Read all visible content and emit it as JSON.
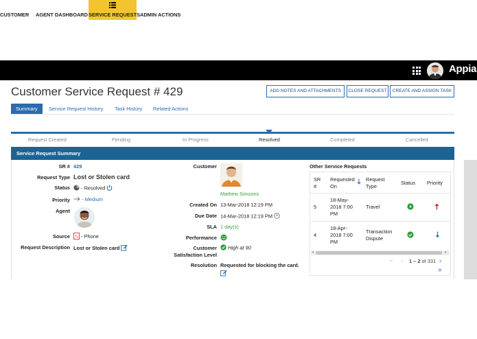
{
  "nav": {
    "items": [
      {
        "label": "CUSTOMER",
        "icon": "users-icon"
      },
      {
        "label": "AGENT DASHBOARD",
        "icon": "user-circle-icon"
      },
      {
        "label": "SERVICE REQUESTS",
        "icon": "list-icon",
        "active": true
      },
      {
        "label": "ADMIN ACTIONS",
        "icon": "move-icon"
      }
    ],
    "brand": "Appian"
  },
  "header": {
    "title": "Customer Service Request # 429",
    "buttons": {
      "add_notes": "ADD NOTES AND ATTACHMENTS",
      "close": "CLOSE REQUEST",
      "create_assign": "CREATE AND ASSIGN TASK"
    }
  },
  "tabs": [
    "Summary",
    "Service Request History",
    "Task History",
    "Related Actions"
  ],
  "stages": [
    "Request Created",
    "Pending",
    "In Progress",
    "Resolved",
    "Completed",
    "Cancelled"
  ],
  "current_stage": "Resolved",
  "panel": {
    "title": "Service Request Summary"
  },
  "summary": {
    "sr_label": "SR #",
    "sr_value": "429",
    "type_label": "Request Type",
    "type_value": "Lost or Stolen card",
    "status_label": "Status",
    "status_value": "- Resolved",
    "priority_label": "Priority",
    "priority_value": "- Medium",
    "agent_label": "Agent",
    "source_label": "Source",
    "source_value": "- Phone",
    "desc_label": "Request Description",
    "desc_value": "Lost or Stolen card"
  },
  "customer": {
    "customer_label": "Customer",
    "customer_name": "Mathew Simsons",
    "created_label": "Created On",
    "created_value": "13-Mar-2018 12:19 PM",
    "due_label": "Due Date",
    "due_value": "14-Mar-2018 12:19 PM",
    "sla_label": "SLA",
    "sla_value": "1 day(s)",
    "perf_label": "Performance",
    "sat_label_1": "Customer",
    "sat_label_2": "Satisfaction Level",
    "sat_value": "High at 90",
    "resolution_label": "Resolution",
    "resolution_value": "Requested for blocking the card."
  },
  "other_requests": {
    "title": "Other Service Requests",
    "headers": {
      "sr_1": "SR",
      "sr_2": "#",
      "req_1": "Requested",
      "req_2": "On",
      "type_1": "Request",
      "type_2": "Type",
      "status": "Status",
      "priority": "Priority"
    },
    "rows": [
      {
        "sr": "5",
        "req_1": "18-May-",
        "req_2": "2018 7:00",
        "req_3": "PM",
        "type_1": "Travel",
        "type_2": "",
        "status": "play",
        "priority": "up"
      },
      {
        "sr": "4",
        "req_1": "18-Apr-",
        "req_2": "2018 7:00",
        "req_3": "PM",
        "type_1": "Transaction",
        "type_2": "Dispute",
        "status": "check",
        "priority": "down"
      }
    ],
    "pager": {
      "range": "1 – 2",
      "of": " of 331"
    }
  },
  "colors": {
    "nav_active": "#f4c430",
    "panel_header": "#1a6496",
    "link": "#2a6cb0",
    "success": "#2e9e3e",
    "priority_up": "#d62020"
  }
}
